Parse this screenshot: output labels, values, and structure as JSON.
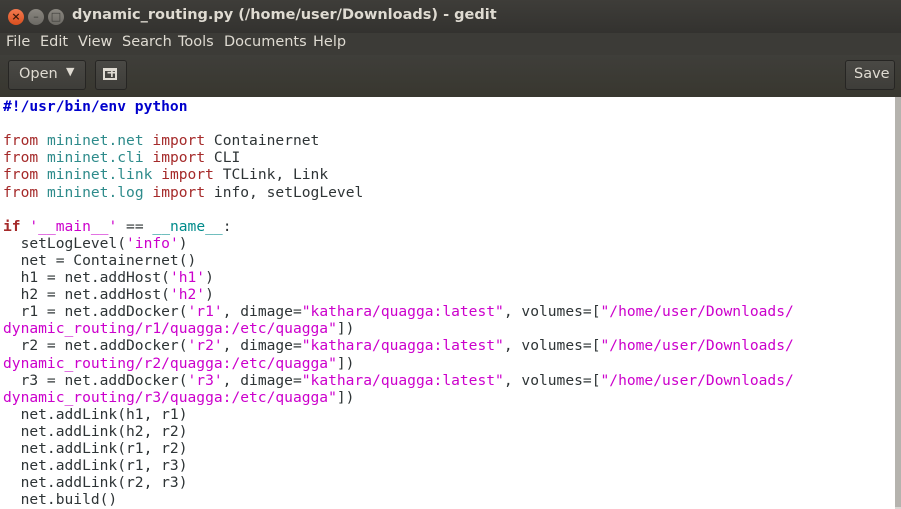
{
  "window": {
    "title": "dynamic_routing.py (/home/user/Downloads) - gedit"
  },
  "menubar": {
    "items": [
      "File",
      "Edit",
      "View",
      "Search",
      "Tools",
      "Documents",
      "Help"
    ]
  },
  "toolbar": {
    "open_label": "Open",
    "save_label": "Save"
  },
  "icons": {
    "close": "close-icon",
    "minimize": "minimize-icon",
    "maximize": "maximize-icon",
    "open_dropdown": "chevron-down-icon",
    "new_tab": "new-tab-icon"
  },
  "editor": {
    "lines": [
      "#!/usr/bin/env python",
      "",
      "from mininet.net import Containernet",
      "from mininet.cli import CLI",
      "from mininet.link import TCLink, Link",
      "from mininet.log import info, setLogLevel",
      "",
      "if '__main__' == __name__:",
      "  setLogLevel('info')",
      "  net = Containernet()",
      "  h1 = net.addHost('h1')",
      "  h2 = net.addHost('h2')",
      "  r1 = net.addDocker('r1', dimage=\"kathara/quagga:latest\", volumes=[\"/home/user/Downloads/",
      "dynamic_routing/r1/quagga:/etc/quagga\"])",
      "  r2 = net.addDocker('r2', dimage=\"kathara/quagga:latest\", volumes=[\"/home/user/Downloads/",
      "dynamic_routing/r2/quagga:/etc/quagga\"])",
      "  r3 = net.addDocker('r3', dimage=\"kathara/quagga:latest\", volumes=[\"/home/user/Downloads/",
      "dynamic_routing/r3/quagga:/etc/quagga\"])",
      "  net.addLink(h1, r1)",
      "  net.addLink(h2, r2)",
      "  net.addLink(r1, r2)",
      "  net.addLink(r1, r3)",
      "  net.addLink(r2, r3)",
      "  net.build()"
    ]
  }
}
